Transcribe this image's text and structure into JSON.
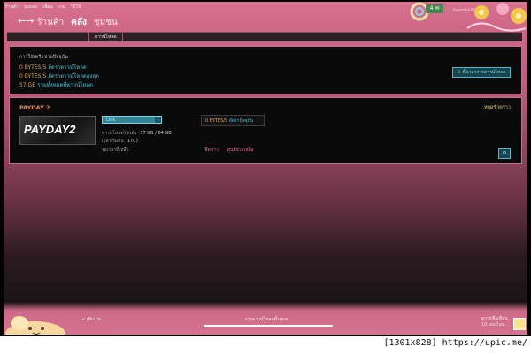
{
  "topbar": {
    "menu": [
      "ร้านค้า",
      "มุมมอง",
      "เพื่อน",
      "เกม",
      "วิธีใช้"
    ],
    "main_nav": [
      "ร้านค้า",
      "คลัง",
      "ชุมชน"
    ],
    "active_nav": "คลัง",
    "notify_count": "4",
    "notify_icon": "envelope-icon",
    "username": "lovedaki0786"
  },
  "subnav": {
    "tab": "ดาวน์โหลด"
  },
  "summary": {
    "title": "การใช้เครือข่ายปัจจุบัน",
    "current_rate_value": "0 BYTES/S",
    "current_rate_label": "อัตราดาวน์โหลด",
    "peak_rate_value": "0 BYTES/S",
    "peak_rate_label": "อัตราดาวน์โหลดสูงสุด",
    "total_value": "57 GB",
    "total_label": "รวมทั้งหมดที่ดาวน์โหลด",
    "schedule_button": "ตั้งเวลาการดาวน์โหลด"
  },
  "game": {
    "title": "PAYDAY 2",
    "banner_text": "PAYDAY2",
    "pause_label": "หยุดชั่วคราว",
    "status_button": "Link",
    "progress_percent": 89,
    "downloaded_label": "ดาวน์โหลดไปแล้ว",
    "downloaded_value": "57 GB / 64 GB",
    "time_label": "เวลาเริ่มต้น",
    "time_value": "1707",
    "remaining_label": "รอเวลาที่เหลือ",
    "rate_value": "0 BYTES/S",
    "rate_label": "อัตราปัจจุบัน",
    "link_news": "ฟีดข่าว",
    "link_support": "ศูนย์ช่วยเหลือ",
    "settings_icon": "gear-icon"
  },
  "footer": {
    "add_game": "เพิ่มเกม...",
    "status": "การดาวน์โหลดทั้งหมด",
    "progress_percent": 100,
    "friends_label": "ดูรายชื่อเพื่อน",
    "friends_online": "10 ออนไลน์"
  },
  "watermark": "[1301x828] https://upic.me/",
  "colors": {
    "accent_pink": "#d6728f",
    "value_orange": "#d9a55c",
    "label_cyan": "#4dc0d6",
    "button_teal": "#16454f"
  }
}
